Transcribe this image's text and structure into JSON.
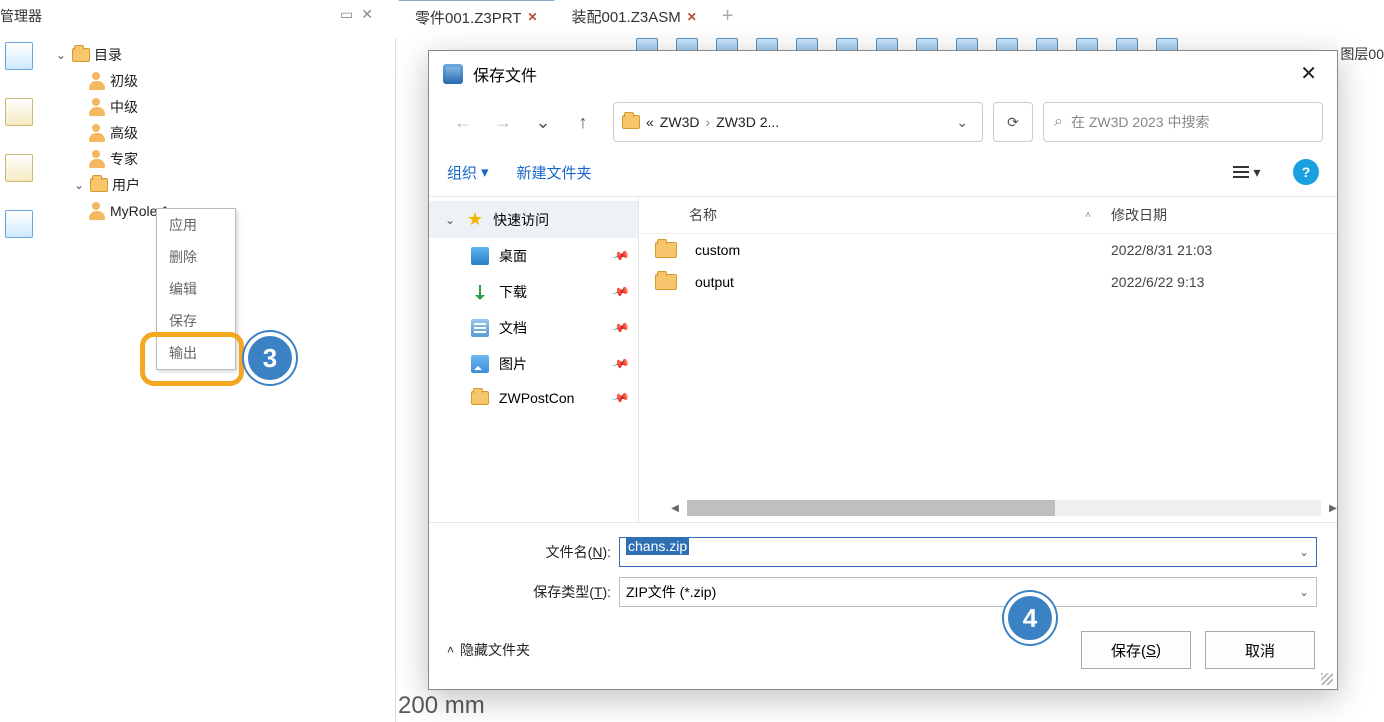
{
  "panel": {
    "title": "管理器"
  },
  "tabs": [
    {
      "label": "零件001.Z3PRT",
      "active": true
    },
    {
      "label": "装配001.Z3ASM",
      "active": false
    }
  ],
  "layers_label": "图层00",
  "tree": {
    "root": {
      "label": "目录"
    },
    "levels": [
      "初级",
      "中级",
      "高级",
      "专家"
    ],
    "user_group": "用户",
    "user_item": "MyRole 1"
  },
  "context_menu": [
    "应用",
    "删除",
    "编辑",
    "保存",
    "输出"
  ],
  "step_badges": {
    "three": "3",
    "four": "4"
  },
  "scale": "200 mm",
  "dialog": {
    "title": "保存文件",
    "breadcrumb": {
      "prefix": "«",
      "seg1": "ZW3D",
      "seg2": "ZW3D 2..."
    },
    "search_placeholder": "在 ZW3D 2023 中搜索",
    "organize": "组织",
    "new_folder": "新建文件夹",
    "sidebar": {
      "quick": "快速访问",
      "desktop": "桌面",
      "downloads": "下载",
      "documents": "文档",
      "pictures": "图片",
      "zwpost": "ZWPostCon"
    },
    "columns": {
      "name": "名称",
      "date": "修改日期"
    },
    "rows": [
      {
        "name": "custom",
        "date": "2022/8/31 21:03"
      },
      {
        "name": "output",
        "date": "2022/6/22 9:13"
      }
    ],
    "filename_label_pre": "文件名(",
    "filename_label_u": "N",
    "filename_label_post": "):",
    "filetype_label_pre": "保存类型(",
    "filetype_label_u": "T",
    "filetype_label_post": "):",
    "filename_value": "chans.zip",
    "filetype_value": "ZIP文件 (*.zip)",
    "hide_folders": "隐藏文件夹",
    "save_btn_pre": "保存(",
    "save_btn_u": "S",
    "save_btn_post": ")",
    "cancel_btn": "取消"
  }
}
